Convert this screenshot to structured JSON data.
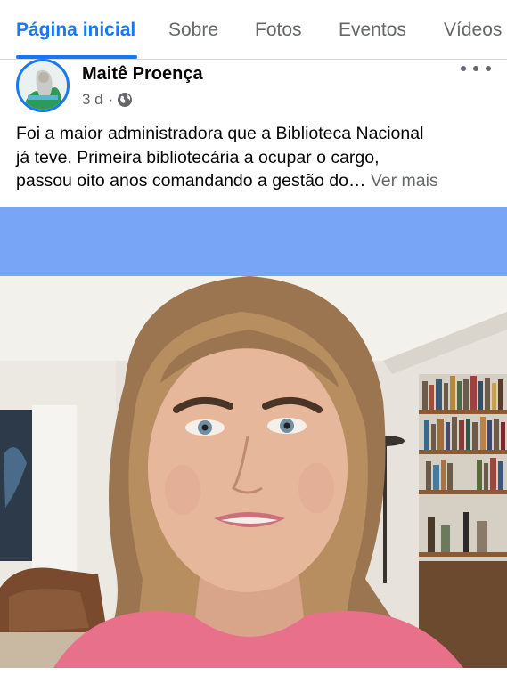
{
  "tabs": [
    {
      "label": "Página inicial",
      "active": true
    },
    {
      "label": "Sobre",
      "active": false
    },
    {
      "label": "Fotos",
      "active": false
    },
    {
      "label": "Eventos",
      "active": false
    },
    {
      "label": "Vídeos",
      "active": false
    }
  ],
  "post": {
    "author": "Maitê Proença",
    "time": "3 d",
    "separator": "·",
    "privacy_icon": "globe-icon",
    "text_lines": [
      "Foi a maior administradora que a Biblioteca Nacional",
      "já teve. Primeira bibliotecária a ocupar o cargo,",
      "passou oito anos comandando a gestão do…"
    ],
    "see_more": "Ver mais"
  },
  "colors": {
    "accent": "#1877f2",
    "secondary_text": "#65676b",
    "video_band": "#78a5f6"
  }
}
